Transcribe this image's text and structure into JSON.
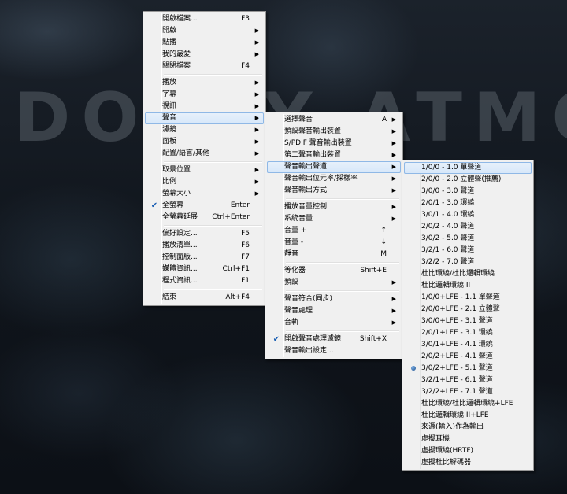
{
  "background_text": "DOLBY ATMOS",
  "main_menu": [
    {
      "label": "開啟檔案...",
      "shortcut": "F3"
    },
    {
      "label": "開啟",
      "arrow": true
    },
    {
      "label": "點播",
      "arrow": true
    },
    {
      "label": "我的最愛",
      "arrow": true
    },
    {
      "label": "關閉檔案",
      "shortcut": "F4"
    },
    {
      "sep": true
    },
    {
      "label": "播放",
      "arrow": true
    },
    {
      "label": "字幕",
      "arrow": true
    },
    {
      "label": "視訊",
      "arrow": true
    },
    {
      "label": "聲音",
      "arrow": true,
      "highlight": true
    },
    {
      "label": "濾鏡",
      "arrow": true
    },
    {
      "label": "面板",
      "arrow": true
    },
    {
      "label": "配置/語言/其他",
      "arrow": true
    },
    {
      "sep": true
    },
    {
      "label": "取景位置",
      "arrow": true
    },
    {
      "label": "比例",
      "arrow": true
    },
    {
      "label": "螢幕大小",
      "arrow": true
    },
    {
      "label": "全螢幕",
      "shortcut": "Enter",
      "check": true
    },
    {
      "label": "全螢幕延展",
      "shortcut": "Ctrl+Enter"
    },
    {
      "sep": true
    },
    {
      "label": "偏好設定...",
      "shortcut": "F5"
    },
    {
      "label": "播放清單...",
      "shortcut": "F6"
    },
    {
      "label": "控制面版...",
      "shortcut": "F7"
    },
    {
      "label": "媒體資訊...",
      "shortcut": "Ctrl+F1"
    },
    {
      "label": "程式資訊...",
      "shortcut": "F1"
    },
    {
      "sep": true
    },
    {
      "label": "結束",
      "shortcut": "Alt+F4"
    }
  ],
  "audio_menu": [
    {
      "label": "選擇聲音",
      "shortcut": "A",
      "arrow": true
    },
    {
      "label": "預設聲音輸出裝置",
      "arrow": true
    },
    {
      "label": "S/PDIF 聲音輸出裝置",
      "arrow": true
    },
    {
      "label": "第二聲音輸出裝置",
      "arrow": true
    },
    {
      "label": "聲音輸出聲道",
      "arrow": true,
      "highlight": true
    },
    {
      "label": "聲音輸出位元率/採樣率",
      "arrow": true
    },
    {
      "label": "聲音輸出方式",
      "arrow": true
    },
    {
      "sep": true
    },
    {
      "label": "播放音量控制",
      "arrow": true
    },
    {
      "label": "系統音量",
      "arrow": true
    },
    {
      "label": "音量 +",
      "shortcut": "↑"
    },
    {
      "label": "音量 -",
      "shortcut": "↓"
    },
    {
      "label": "靜音",
      "shortcut": "M"
    },
    {
      "sep": true
    },
    {
      "label": "等化器",
      "shortcut": "Shift+E"
    },
    {
      "label": "預設",
      "arrow": true
    },
    {
      "sep": true
    },
    {
      "label": "聲音符合(同步)",
      "arrow": true
    },
    {
      "label": "聲音處理",
      "arrow": true
    },
    {
      "label": "音軌",
      "arrow": true
    },
    {
      "sep": true
    },
    {
      "label": "開啟聲音處理濾鏡",
      "shortcut": "Shift+X",
      "check": true
    },
    {
      "label": "聲音輸出設定..."
    }
  ],
  "channel_menu": [
    {
      "label": "1/0/0 - 1.0 單聲道",
      "highlight": true
    },
    {
      "label": "2/0/0 - 2.0 立體聲(推薦)"
    },
    {
      "label": "3/0/0 - 3.0 聲道"
    },
    {
      "label": "2/0/1 - 3.0 環繞"
    },
    {
      "label": "3/0/1 - 4.0 環繞"
    },
    {
      "label": "2/0/2 - 4.0 聲道"
    },
    {
      "label": "3/0/2 - 5.0 聲道"
    },
    {
      "label": "3/2/1 - 6.0 聲道"
    },
    {
      "label": "3/2/2 - 7.0 聲道"
    },
    {
      "label": "杜比環繞/杜比邏輯環繞"
    },
    {
      "label": "杜比邏輯環繞 II"
    },
    {
      "label": "1/0/0+LFE - 1.1 單聲道"
    },
    {
      "label": "2/0/0+LFE - 2.1 立體聲"
    },
    {
      "label": "3/0/0+LFE - 3.1 聲道"
    },
    {
      "label": "2/0/1+LFE - 3.1 環繞"
    },
    {
      "label": "3/0/1+LFE - 4.1 環繞"
    },
    {
      "label": "2/0/2+LFE - 4.1 聲道"
    },
    {
      "label": "3/0/2+LFE - 5.1 聲道",
      "radio": true
    },
    {
      "label": "3/2/1+LFE - 6.1 聲道"
    },
    {
      "label": "3/2/2+LFE - 7.1 聲道"
    },
    {
      "label": "杜比環繞/杜比邏輯環繞+LFE"
    },
    {
      "label": "杜比邏輯環繞 II+LFE"
    },
    {
      "label": "來源(輸入)作為輸出"
    },
    {
      "label": "虛擬耳機"
    },
    {
      "label": "虛擬環繞(HRTF)"
    },
    {
      "label": "虛擬杜比解碼器"
    }
  ]
}
